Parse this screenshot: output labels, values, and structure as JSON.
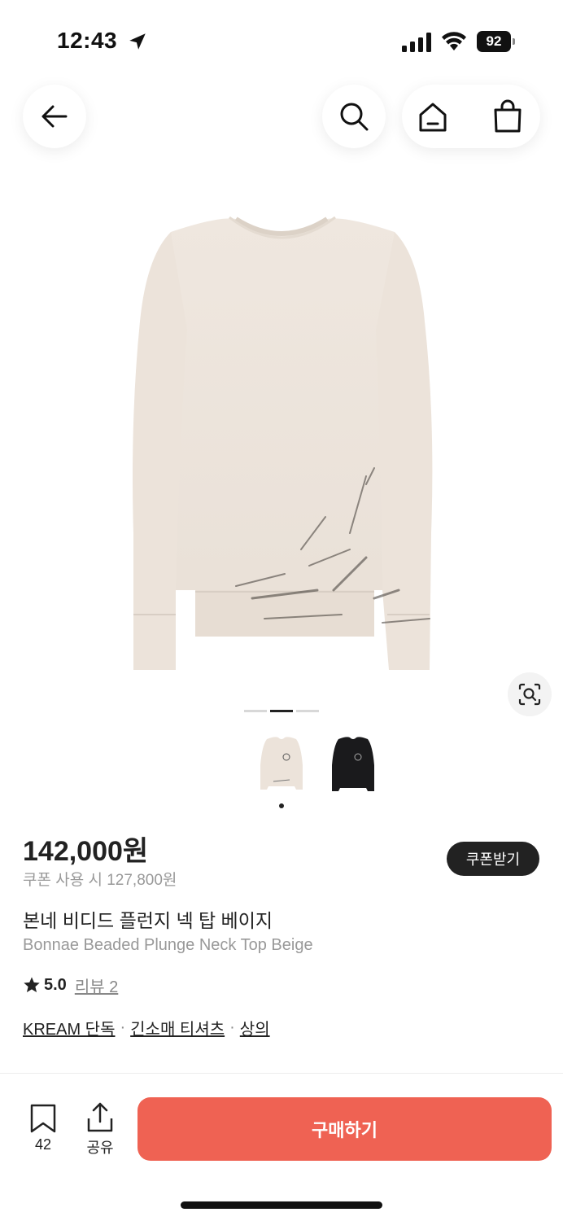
{
  "status_bar": {
    "time": "12:43",
    "battery": "92"
  },
  "product": {
    "price": "142,000원",
    "coupon_price": "쿠폰 사용 시 127,800원",
    "coupon_button": "쿠폰받기",
    "name_ko": "본네 비디드 플런지 넥 탑 베이지",
    "name_en": "Bonnae Beaded Plunge Neck Top Beige",
    "rating": "5.0",
    "review_link": "리뷰 2",
    "categories": [
      "KREAM 단독",
      "긴소매 티셔츠",
      "상의"
    ],
    "category_separator": "·"
  },
  "bottom_bar": {
    "save_count": "42",
    "share_label": "공유",
    "buy_label": "구매하기"
  },
  "colors": {
    "buy_button": "#ef6253",
    "coupon_button": "#222222",
    "garment": "#ece3da"
  },
  "icons": [
    "back-arrow-icon",
    "search-icon",
    "home-icon",
    "shopping-bag-icon",
    "lens-search-icon",
    "star-icon",
    "bookmark-icon",
    "share-icon"
  ]
}
